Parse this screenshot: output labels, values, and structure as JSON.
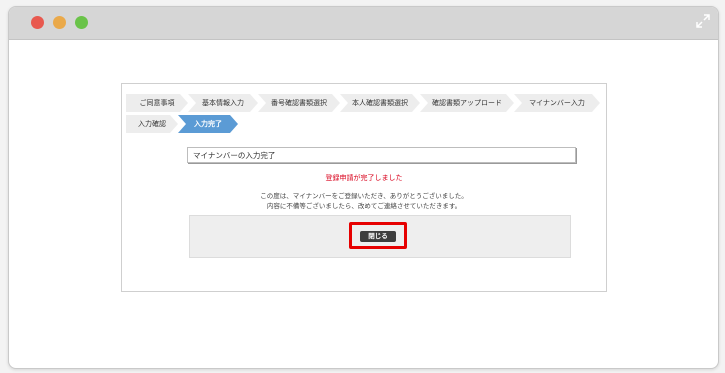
{
  "window": {
    "controls": [
      "close",
      "minimize",
      "zoom"
    ]
  },
  "steps": [
    {
      "label": "ご同意事項",
      "state": "done"
    },
    {
      "label": "基本情報入力",
      "state": "done"
    },
    {
      "label": "番号確認書類選択",
      "state": "done"
    },
    {
      "label": "本人確認書類選択",
      "state": "done"
    },
    {
      "label": "確認書類アップロード",
      "state": "done"
    },
    {
      "label": "マイナンバー入力",
      "state": "done"
    },
    {
      "label": "入力確認",
      "state": "done"
    },
    {
      "label": "入力完了",
      "state": "active"
    }
  ],
  "main": {
    "section_title": "マイナンバーの入力完了",
    "status_text": "登録申請が完了しました",
    "message_line1": "この度は、マイナンバーをご登録いただき、ありがとうございました。",
    "message_line2": "内容に不備等ございましたら、改めてご連絡させていただきます。",
    "close_label": "閉じる"
  },
  "colors": {
    "active_step": "#5b9bd5",
    "inactive_step": "#ededed",
    "status_red": "#d9001b",
    "highlight_red": "#e60000",
    "button_dark": "#3d3d3d"
  }
}
